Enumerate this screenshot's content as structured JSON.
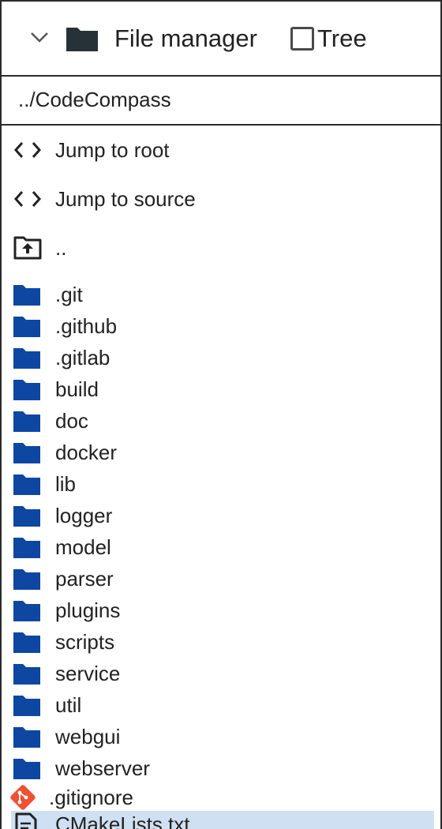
{
  "header": {
    "title": "File manager",
    "tree_label": "Tree",
    "tree_checked": false
  },
  "path": "../CodeCompass",
  "actions": [
    {
      "label": "Jump to root",
      "icon": "code-icon"
    },
    {
      "label": "Jump to source",
      "icon": "code-icon"
    },
    {
      "label": "..",
      "icon": "folder-up-icon"
    }
  ],
  "folders": [
    ".git",
    ".github",
    ".gitlab",
    "build",
    "doc",
    "docker",
    "lib",
    "logger",
    "model",
    "parser",
    "plugins",
    "scripts",
    "service",
    "util",
    "webgui",
    "webserver"
  ],
  "files": [
    {
      "name": ".gitignore",
      "icon": "git-icon"
    },
    {
      "name": "CMakeLists.txt",
      "icon": "text-file-icon",
      "selected": true
    }
  ],
  "colors": {
    "folder": "#0d47a1",
    "header_folder": "#263238",
    "git": "#f05033",
    "selected_bg": "#cfe0f3",
    "border": "#2b2b2b"
  }
}
